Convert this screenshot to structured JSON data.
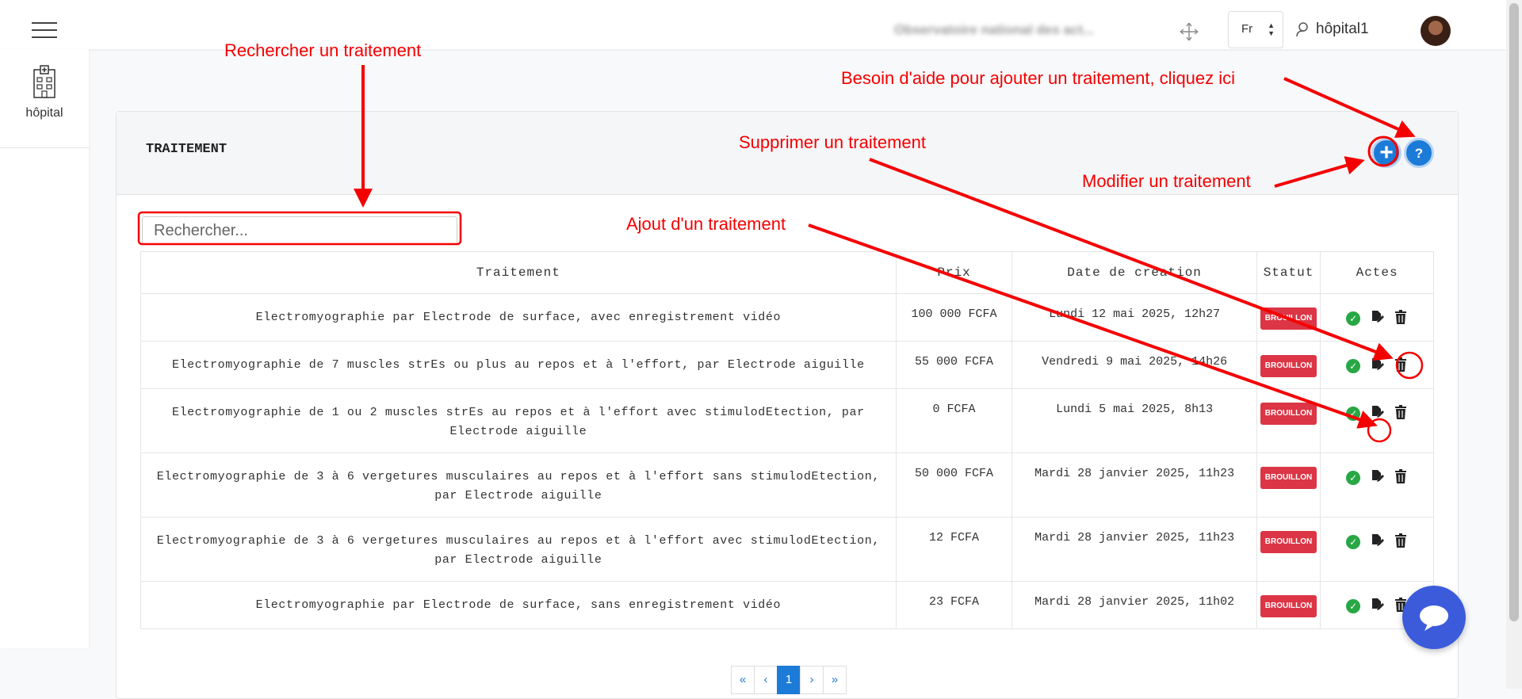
{
  "topbar": {
    "blurred_title": "Observatoire national des act...",
    "language": "Fr",
    "username": "hôpital1"
  },
  "sidebar": {
    "items": [
      {
        "label": "hôpital",
        "icon": "hospital-icon"
      }
    ]
  },
  "card": {
    "title": "TRAITEMENT",
    "add_button_icon": "plus-icon",
    "help_button_label": "?"
  },
  "search": {
    "placeholder": "Rechercher..."
  },
  "table": {
    "headers": [
      "Traitement",
      "Prix",
      "Date de création",
      "Statut",
      "Actes"
    ],
    "rows": [
      {
        "name": "Electromyographie par Electrode de surface, avec enregistrement vidéo",
        "price": "100 000 FCFA",
        "date": "Lundi 12 mai 2025, 12h27",
        "status": "BROUILLON"
      },
      {
        "name": "Electromyographie de 7 muscles strEs ou plus au repos et à l'effort, par Electrode aiguille",
        "price": "55 000 FCFA",
        "date": "Vendredi 9 mai 2025, 14h26",
        "status": "BROUILLON"
      },
      {
        "name": "Electromyographie de 1 ou 2 muscles strEs au repos et à l'effort avec stimulodEtection, par Electrode aiguille",
        "price": "0 FCFA",
        "date": "Lundi 5 mai 2025, 8h13",
        "status": "BROUILLON"
      },
      {
        "name": "Electromyographie de 3 à 6 vergetures musculaires au repos et à l'effort sans stimulodEtection, par Electrode aiguille",
        "price": "50 000 FCFA",
        "date": "Mardi 28 janvier 2025, 11h23",
        "status": "BROUILLON"
      },
      {
        "name": "Electromyographie de 3 à 6 vergetures musculaires au repos et à l'effort avec stimulodEtection, par Electrode aiguille",
        "price": "12 FCFA",
        "date": "Mardi 28 janvier 2025, 11h23",
        "status": "BROUILLON"
      },
      {
        "name": "Electromyographie par Electrode de surface, sans enregistrement vidéo",
        "price": "23 FCFA",
        "date": "Mardi 28 janvier 2025, 11h02",
        "status": "BROUILLON"
      }
    ]
  },
  "pagination": {
    "first": "«",
    "prev": "‹",
    "current": "1",
    "next": "›",
    "last": "»"
  },
  "annotations": {
    "search": "Rechercher un traitement",
    "help": "Besoin d'aide pour ajouter un traitement, cliquez ici",
    "delete": "Supprimer un traitement",
    "edit": "Modifier un traitement",
    "add": "Ajout d'un traitement"
  },
  "colors": {
    "accent": "#1d7bd8",
    "annotation": "#f50000",
    "badge": "#dc3545",
    "validate": "#28a745",
    "chat": "#3b5bdb"
  }
}
